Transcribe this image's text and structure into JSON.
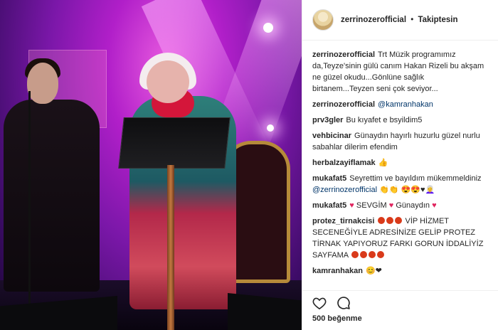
{
  "header": {
    "username": "zerrinozerofficial",
    "separator": "•",
    "follow_status": "Takiptesin"
  },
  "comments": [
    {
      "user": "zerrinozerofficial",
      "text": "Trt Müzik programımız da,Teyze'sinin gülü canım Hakan Rizeli bu akşam ne güzel okudu...Gönlüne sağlık birtanem...Teyzen seni çok seviyor..."
    },
    {
      "user": "zerrinozerofficial",
      "mention": "@kamranhakan"
    },
    {
      "user": "prv3gler",
      "text": "Bu kıyafet e bsyildim5"
    },
    {
      "user": "vehbicinar",
      "text": "Günaydın hayırlı huzurlu güzel nurlu sabahlar dilerim efendim"
    },
    {
      "user": "herbalzayiflamak",
      "text": "👍"
    },
    {
      "user": "mukafat5",
      "text": "Seyrettim ve bayıldım mükemmeldiniz",
      "mention": "@zerrinozerofficial",
      "emoji": "👏👏 😍😍♥👩‍🦳"
    },
    {
      "user": "mukafat5",
      "text_a": "SEVGİM",
      "text_b": "Günaydın"
    },
    {
      "user": "protez_tirnakcisi",
      "text": "VİP HİZMET SECENEĞİYLE ADRESİNİZE GELİP PROTEZ TİRNAK YAPIYORUZ FARKI GORUN İDDALİYİZ SAYFAMA"
    },
    {
      "user": "kamranhakan",
      "emoji": "😊❤"
    }
  ],
  "actions": {
    "like_icon": "heart-outline-icon",
    "comment_icon": "speech-bubble-icon"
  },
  "likes_text": "500 beğenme",
  "colors": {
    "text": "#262626",
    "mention": "#003569",
    "heart": "#e0245e",
    "divider": "#efefef"
  }
}
